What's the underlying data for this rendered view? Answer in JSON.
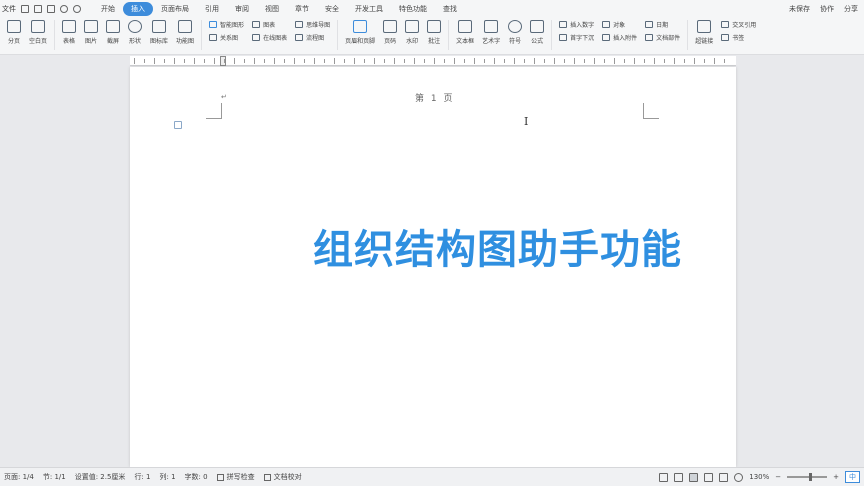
{
  "menubar": {
    "file_label": "文件",
    "tabs": [
      {
        "label": "开始",
        "active": false
      },
      {
        "label": "插入",
        "active": true
      },
      {
        "label": "页面布局",
        "active": false
      },
      {
        "label": "引用",
        "active": false
      },
      {
        "label": "审阅",
        "active": false
      },
      {
        "label": "视图",
        "active": false
      },
      {
        "label": "章节",
        "active": false
      },
      {
        "label": "安全",
        "active": false
      },
      {
        "label": "开发工具",
        "active": false
      },
      {
        "label": "特色功能",
        "active": false
      },
      {
        "label": "查找",
        "active": false
      }
    ],
    "right": [
      "未保存",
      "协作",
      "分享"
    ]
  },
  "ribbon": {
    "group1": [
      "分页",
      "空白页"
    ],
    "group2": [
      "表格",
      "图片",
      "截屏",
      "形状",
      "图标库",
      "功能图"
    ],
    "group3": {
      "row1": "智能图形",
      "row2": "关系图"
    },
    "group4": {
      "row1": "图表",
      "row2": "在线图表"
    },
    "group5": {
      "row1": "思维导图",
      "row2": "流程图"
    },
    "group6": [
      "页眉和页脚",
      "页码",
      "水印",
      "批注"
    ],
    "group7": [
      "文本框",
      "艺术字",
      "符号",
      "公式"
    ],
    "group8": {
      "row1": "插入数字",
      "row2": "首字下沉"
    },
    "group9": {
      "row1": "对象",
      "row2": "插入附件"
    },
    "group10": {
      "row1": "日期",
      "row2": "文档部件"
    },
    "group11": [
      "超链接"
    ],
    "group12": {
      "row1": "交叉引用",
      "row2": "书签"
    }
  },
  "page": {
    "header_text": "第 1 页",
    "title": "组织结构图助手功能"
  },
  "statusbar": {
    "page": "页面: 1/4",
    "section": "节: 1/1",
    "position": "设置值: 2.5厘米",
    "line": "行: 1",
    "column": "列: 1",
    "words": "字数: 0",
    "spellcheck": "拼写检查",
    "proofread": "文档校对",
    "zoom": "130%",
    "ime": "中"
  }
}
